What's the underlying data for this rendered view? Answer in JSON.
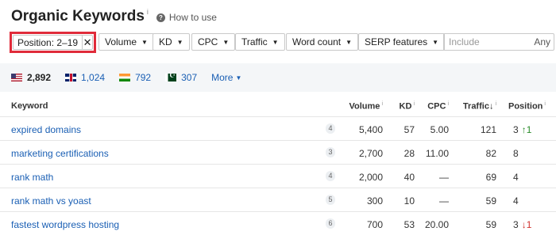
{
  "header": {
    "title": "Organic Keywords",
    "title_info": "i",
    "how_to_label": "How to use"
  },
  "filters": {
    "position": {
      "label": "Position: 2–19",
      "clear": "✕"
    },
    "volume": "Volume",
    "kd": "KD",
    "cpc": "CPC",
    "traffic": "Traffic",
    "word_count": "Word count",
    "serp_features": "SERP features",
    "include_placeholder": "Include",
    "any_label": "Any"
  },
  "countries": [
    {
      "code": "us",
      "value": "2,892",
      "active": true
    },
    {
      "code": "gb",
      "value": "1,024",
      "active": false
    },
    {
      "code": "in",
      "value": "792",
      "active": false
    },
    {
      "code": "pk",
      "value": "307",
      "active": false
    }
  ],
  "more_label": "More",
  "table": {
    "columns": {
      "keyword": "Keyword",
      "volume": "Volume",
      "kd": "KD",
      "cpc": "CPC",
      "traffic": "Traffic",
      "traffic_sort": "↓",
      "position": "Position",
      "info": "i"
    },
    "rows": [
      {
        "keyword": "expired domains",
        "words": "4",
        "volume": "5,400",
        "kd": "57",
        "cpc": "5.00",
        "traffic": "121",
        "position": "3",
        "change": "↑1",
        "change_dir": "up"
      },
      {
        "keyword": "marketing certifications",
        "words": "3",
        "volume": "2,700",
        "kd": "28",
        "cpc": "11.00",
        "traffic": "82",
        "position": "8",
        "change": "",
        "change_dir": ""
      },
      {
        "keyword": "rank math",
        "words": "4",
        "volume": "2,000",
        "kd": "40",
        "cpc": "—",
        "traffic": "69",
        "position": "4",
        "change": "",
        "change_dir": ""
      },
      {
        "keyword": "rank math vs yoast",
        "words": "5",
        "volume": "300",
        "kd": "10",
        "cpc": "—",
        "traffic": "59",
        "position": "4",
        "change": "",
        "change_dir": ""
      },
      {
        "keyword": "fastest wordpress hosting",
        "words": "6",
        "volume": "700",
        "kd": "53",
        "cpc": "20.00",
        "traffic": "59",
        "position": "3",
        "change": "↓1",
        "change_dir": "down"
      }
    ]
  },
  "colors": {
    "link": "#1a5fb4",
    "highlight_border": "#e02b3a",
    "up": "#2a8c2a",
    "down": "#d0312d"
  }
}
